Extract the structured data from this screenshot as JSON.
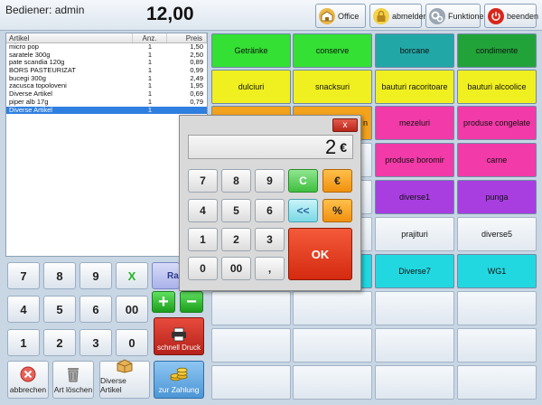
{
  "header": {
    "user_label": "Bediener: admin",
    "total": "12,00",
    "buttons": [
      {
        "label": "Office",
        "icon": "office-icon"
      },
      {
        "label": "abmelden",
        "icon": "lock-icon"
      },
      {
        "label": "Funktionen",
        "icon": "gears-icon"
      },
      {
        "label": "beenden",
        "icon": "power-icon"
      }
    ]
  },
  "list": {
    "columns": [
      "Artikel",
      "Anz.",
      "Preis"
    ],
    "rows": [
      [
        "micro pop",
        "1",
        "1,50"
      ],
      [
        "saratele 300g",
        "1",
        "2,50"
      ],
      [
        "pate scandia 120g",
        "1",
        "0,89"
      ],
      [
        "BORS PASTEURIZAT",
        "1",
        "0,99"
      ],
      [
        "bucegi 300g",
        "1",
        "2,49"
      ],
      [
        "zacusca topoloveni",
        "1",
        "1,95"
      ],
      [
        "Diverse Artikel",
        "1",
        "0,69"
      ],
      [
        "piper alb 17g",
        "1",
        "0,79"
      ],
      [
        "Diverse Artikel",
        "1",
        ""
      ]
    ]
  },
  "keypad": {
    "row1": [
      "7",
      "8",
      "9",
      "X"
    ],
    "row2": [
      "4",
      "5",
      "6",
      "00"
    ],
    "row3": [
      "1",
      "2",
      "3",
      "0"
    ],
    "rabatt_label": "Rab",
    "plus": "+",
    "minus": "−",
    "schnell_label": "schnell Druck"
  },
  "bottom": {
    "abbrechen": "abbrechen",
    "art_loeschen": "Art löschen",
    "diverse_artikel": "Diverse Artikel",
    "zur_zahlung": "zur Zahlung"
  },
  "categories": [
    {
      "label": "Getränke",
      "color": "#33e033"
    },
    {
      "label": "conserve",
      "color": "#33e033"
    },
    {
      "label": "borcane",
      "color": "#22a7a7"
    },
    {
      "label": "condimente",
      "color": "#22a33a"
    },
    {
      "label": "dulciuri",
      "color": "#f0f020"
    },
    {
      "label": "snacksuri",
      "color": "#f0f020"
    },
    {
      "label": "bauturi racoritoare",
      "color": "#f0f020"
    },
    {
      "label": "bauturi alcoolice",
      "color": "#f0f020"
    },
    {
      "label": "n",
      "color": "#f2a21c"
    },
    {
      "label": "mezeluri",
      "color": "#f23aa8"
    },
    {
      "label": "produse congelate",
      "color": "#f23aa8"
    },
    {
      "label": "produse boromir",
      "color": "#f23aa8"
    },
    {
      "label": "carne",
      "color": "#f23aa8"
    },
    {
      "label": "diverse1",
      "color": "#a83ee0"
    },
    {
      "label": "punga",
      "color": "#a83ee0"
    },
    {
      "label": "prajituri",
      "color": "#eef2f5"
    },
    {
      "label": "diverse5",
      "color": "#eef2f5"
    },
    {
      "label": "Diverse7",
      "color": "#22d8e0"
    },
    {
      "label": "WG1",
      "color": "#22d8e0"
    }
  ],
  "calculator": {
    "close": "x",
    "value": "2",
    "currency": "€",
    "rows": [
      [
        "7",
        "8",
        "9",
        "C",
        "€"
      ],
      [
        "4",
        "5",
        "6",
        "<<",
        "%"
      ],
      [
        "1",
        "2",
        "3"
      ],
      [
        "0",
        "00",
        ","
      ]
    ],
    "ok": "OK"
  }
}
